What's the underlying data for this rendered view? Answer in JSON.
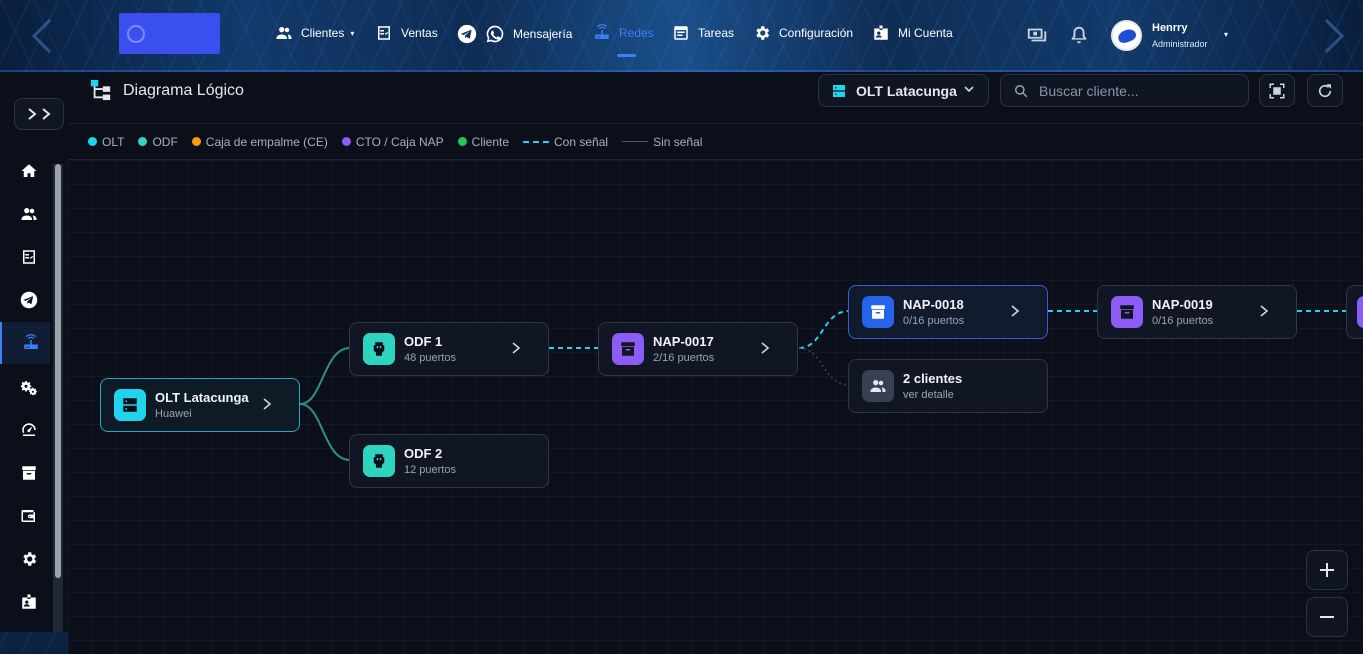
{
  "nav": {
    "items": [
      {
        "label": "Clientes",
        "icon": "users-icon",
        "has_caret": true
      },
      {
        "label": "Ventas",
        "icon": "checklist-icon"
      },
      {
        "label": "Mensajería",
        "icon": "telegram-icon"
      },
      {
        "label": "Redes",
        "icon": "router-icon",
        "active": true
      },
      {
        "label": "Tareas",
        "icon": "calendar-icon"
      },
      {
        "label": "Configuración",
        "icon": "gear-icon"
      },
      {
        "label": "Mi Cuenta",
        "icon": "id-badge-icon"
      }
    ],
    "caret": "▾"
  },
  "user": {
    "name": "Henrry",
    "role": "Administrador",
    "caret": "▾"
  },
  "page": {
    "title": "Diagrama Lógico"
  },
  "toolbar": {
    "olt_selected": "OLT Latacunga",
    "search_placeholder": "Buscar cliente..."
  },
  "legend": [
    {
      "label": "OLT",
      "color": "#22d3ee",
      "kind": "dot"
    },
    {
      "label": "ODF",
      "color": "#2dd4bf",
      "kind": "dot"
    },
    {
      "label": "Caja de empalme (CE)",
      "color": "#f59e0b",
      "kind": "dot"
    },
    {
      "label": "CTO / Caja NAP",
      "color": "#8b5cf6",
      "kind": "dot"
    },
    {
      "label": "Cliente",
      "color": "#22c55e",
      "kind": "dot"
    },
    {
      "label": "Con señal",
      "color": "#22d3ee",
      "kind": "dash"
    },
    {
      "label": "Sin señal",
      "color": "#4b5563",
      "kind": "solid"
    }
  ],
  "nodes": {
    "olt": {
      "title": "OLT Latacunga",
      "subtitle": "Huawei"
    },
    "odf1": {
      "title": "ODF 1",
      "subtitle": "48 puertos"
    },
    "odf2": {
      "title": "ODF 2",
      "subtitle": "12 puertos"
    },
    "nap17": {
      "title": "NAP-0017",
      "subtitle": "2/16 puertos"
    },
    "nap18": {
      "title": "NAP-0018",
      "subtitle": "0/16 puertos"
    },
    "nap19": {
      "title": "NAP-0019",
      "subtitle": "0/16 puertos"
    },
    "clients": {
      "title": "2 clientes",
      "subtitle": "ver detalle"
    }
  },
  "zoom": {
    "in": "+",
    "out": "−"
  },
  "colors": {
    "olt": "#22d3ee",
    "odf": "#2dd4bf",
    "nap": "#8b5cf6",
    "nap_selected": "#2563eb",
    "client": "#374151",
    "accent": "#3b82f6"
  }
}
